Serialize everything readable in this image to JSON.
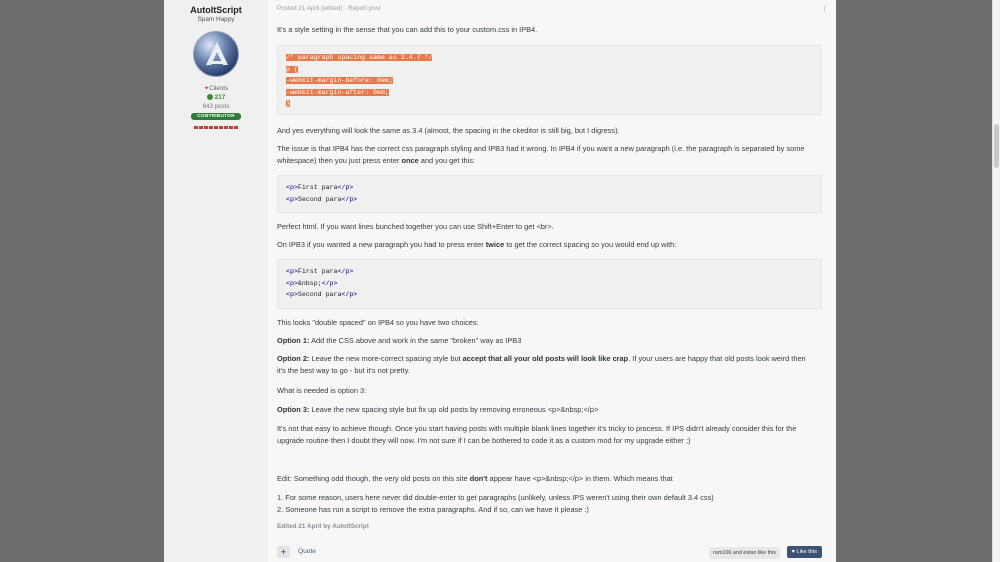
{
  "author": {
    "name": "AutoItScript",
    "title": "Spam Happy",
    "group": "Clients",
    "reputation": "217",
    "posts": "643 posts",
    "badge": "CONTRIBUTOR",
    "pip_count": 9
  },
  "post": {
    "date": "Posted 21 April (edited)",
    "report": "Report post",
    "p1": "It's a style setting in the sense that you can add this to your custom.css in IPB4.",
    "code1": [
      "/* paragraph spacing same as 3.4.7 */",
      "p {",
      "-webkit-margin-before: 0em;",
      "-webkit-margin-after: 0em;",
      "}"
    ],
    "p2": "And yes everything will look the same as 3.4 (almost, the spacing in the ckeditor is still big, but I digress).",
    "p3a": "The issue is that IPB4 has the correct css paragraph styling and IPB3 had it wrong.  In IPB4 if you want a new paragraph (i.e. the paragraph is separated by some",
    "p3b": "whitespace) then you just press enter ",
    "p3b_bold": "once",
    "p3b_end": " and you get this:",
    "code2": [
      {
        "open": "<p>",
        "text": "First para",
        "close": "</p>"
      },
      {
        "open": "<p>",
        "text": "Second para",
        "close": "</p>"
      }
    ],
    "p4": "Perfect html.  If you want lines bunched together you can use Shift+Enter to get <br>.",
    "p5a": "On IPB3 if you wanted a new paragraph you had to press enter ",
    "p5_bold": "twice",
    "p5b": " to get the correct spacing so you would end up with:",
    "code3": [
      {
        "open": "<p>",
        "text": "First para",
        "close": "</p>"
      },
      {
        "open": "<p>",
        "text": "&nbsp;",
        "close": "</p>"
      },
      {
        "open": "<p>",
        "text": "Second para",
        "close": "</p>"
      }
    ],
    "p6": "This looks \"double spaced\" on IPB4 so you have two choices:",
    "opt1_label": "Option 1:",
    "opt1_text": " Add the CSS above and work in the same \"broken\" way as IPB3",
    "opt2_label": "Option 2:",
    "opt2_text": " Leave the new more-correct spacing style but ",
    "opt2_bold": "accept that all your old posts will look like crap",
    "opt2_end": ". If your users are happy that old posts look weird then",
    "opt2_line2": "it's the best way to go - but it's not pretty.",
    "p7": "What is needed is option 3:",
    "opt3_label": "Option 3:",
    "opt3_text": " Leave the new spacing style but fix up old posts by removing erroneous <p>&nbsp;</p>",
    "p8a": "It's not that easy to achieve though. Once you start having posts with multiple blank lines together it's tricky to process. If IPS didn't already consider this for the",
    "p8b": "upgrade routine then I doubt they will now. I'm not sure if I can be bothered to code it as a custom mod for my upgrade either ;)",
    "p9a": "Edit: Something odd though, the very old posts on this site ",
    "p9_bold": "don't",
    "p9b": " appear have <p>&nbsp;</p> in them. Which means that",
    "p10": "1. For some reason, users here never did double-enter to get paragraphs (unlikely, unless IPS weren't using their own default 3.4 css)",
    "p11": "2. Someone has run a script to remove the extra paragraphs.  And if so, can we have it please :)",
    "edited": "Edited 21 April by AutoItScript"
  },
  "footer": {
    "plus": "+",
    "quote": "Quote",
    "likers": "ram106 and estan like this",
    "like": "Like this"
  },
  "colors": {
    "selection": "#e87a4a",
    "badge": "#2c7d37",
    "like_button": "#3d5273"
  }
}
